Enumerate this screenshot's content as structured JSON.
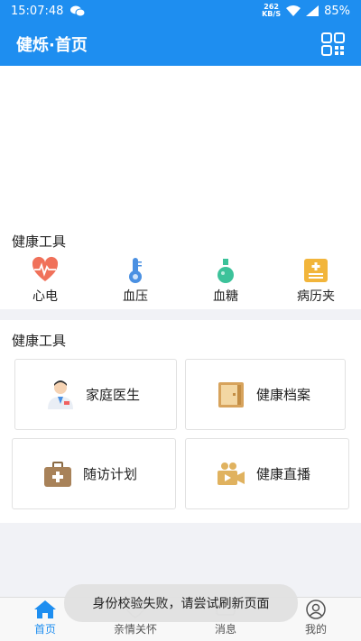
{
  "status_bar": {
    "time": "15:07:48",
    "speed_value": "262",
    "speed_unit": "KB/S",
    "battery": "85%"
  },
  "app_bar": {
    "title": "健烁·首页"
  },
  "health_tools": {
    "title": "健康工具",
    "items": [
      {
        "label": "心电",
        "icon": "heart-ecg-icon"
      },
      {
        "label": "血压",
        "icon": "thermometer-icon"
      },
      {
        "label": "血糖",
        "icon": "flask-icon"
      },
      {
        "label": "病历夹",
        "icon": "medical-record-icon"
      }
    ]
  },
  "services": {
    "title": "健康工具",
    "items": [
      {
        "label": "家庭医生",
        "icon": "doctor-icon"
      },
      {
        "label": "健康档案",
        "icon": "archive-cabinet-icon"
      },
      {
        "label": "随访计划",
        "icon": "medical-kit-icon"
      },
      {
        "label": "健康直播",
        "icon": "video-camera-icon"
      }
    ]
  },
  "tab_bar": {
    "items": [
      {
        "label": "首页",
        "icon": "home-icon",
        "active": true
      },
      {
        "label": "亲情关怀",
        "icon": "family-care-icon",
        "active": false
      },
      {
        "label": "消息",
        "icon": "message-icon",
        "active": false
      },
      {
        "label": "我的",
        "icon": "profile-icon",
        "active": false
      }
    ]
  },
  "toast": {
    "message": "身份校验失败，请尝试刷新页面"
  },
  "colors": {
    "primary": "#1e8ef0",
    "heart": "#f0715a",
    "gold": "#f2b53b"
  }
}
